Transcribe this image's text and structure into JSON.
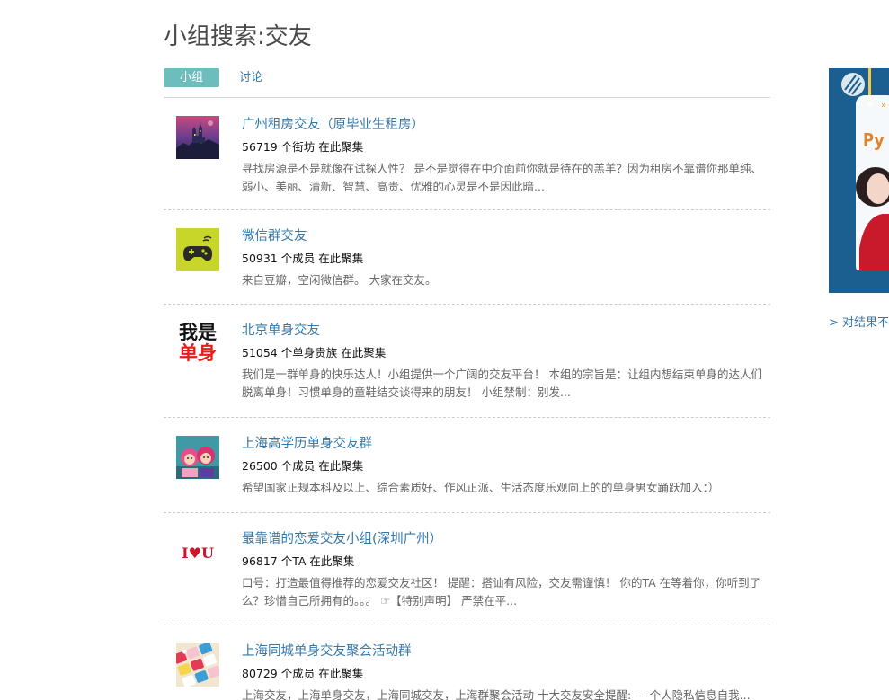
{
  "page": {
    "title": "小组搜索:交友"
  },
  "tabs": [
    {
      "label": "小组",
      "active": true
    },
    {
      "label": "讨论",
      "active": false
    }
  ],
  "results": [
    {
      "title": "广州租房交友（原毕业生租房）",
      "meta": "56719 个街坊 在此聚集",
      "desc": "寻找房源是不是就像在试探人性？ 是不是觉得在中介面前你就是待在的羔羊？因为租房不靠谱你那单纯、弱小、美丽、清新、智慧、高贵、优雅的心灵是不是因此暗...",
      "thumb_icon": "castle-photo-icon"
    },
    {
      "title": "微信群交友",
      "meta": "50931 个成员 在此聚集",
      "desc": "来自豆瓣，空闲微信群。 大家在交友。",
      "thumb_icon": "gamepad-icon"
    },
    {
      "title": "北京单身交友",
      "meta": "51054 个单身贵族 在此聚集",
      "desc": "我们是一群单身的快乐达人！小组提供一个广阔的交友平台！ 本组的宗旨是：让组内想结束单身的达人们脱离单身！习惯单身的童鞋结交谈得来的朋友！ 小组禁制：别发...",
      "thumb_icon": "logo-text-icon",
      "thumb_text_top": "我是",
      "thumb_text_bottom": "单身"
    },
    {
      "title": "上海高学历单身交友群",
      "meta": "26500 个成员 在此聚集",
      "desc": "希望国家正规本科及以上、综合素质好、作风正派、生活态度乐观向上的的单身男女踊跃加入：）",
      "thumb_icon": "cartoon-couple-icon"
    },
    {
      "title": "最靠谱的恋爱交友小组(深圳广州）",
      "meta": "96817 个TA 在此聚集",
      "desc": "口号：打造最值得推荐的恋爱交友社区！ 提醒：搭讪有风险，交友需谨慎！ 你的TA 在等着你，你听到了么？珍惜自己所拥有的。。。 ☞【特别声明】 严禁在平...",
      "thumb_icon": "i-love-u-icon",
      "thumb_text": "I♥U"
    },
    {
      "title": "上海同城单身交友聚会活动群",
      "meta": "80729 个成员 在此聚集",
      "desc": "上海交友，上海单身交友，上海同城交友，上海群聚会活动 十大交友安全提醒: — 个人隐私信息自我...",
      "thumb_icon": "keyboard-hearts-icon"
    }
  ],
  "ad": {
    "text": "Py",
    "arrows": "»"
  },
  "feedback": {
    "label": "> 对结果不满意？"
  }
}
